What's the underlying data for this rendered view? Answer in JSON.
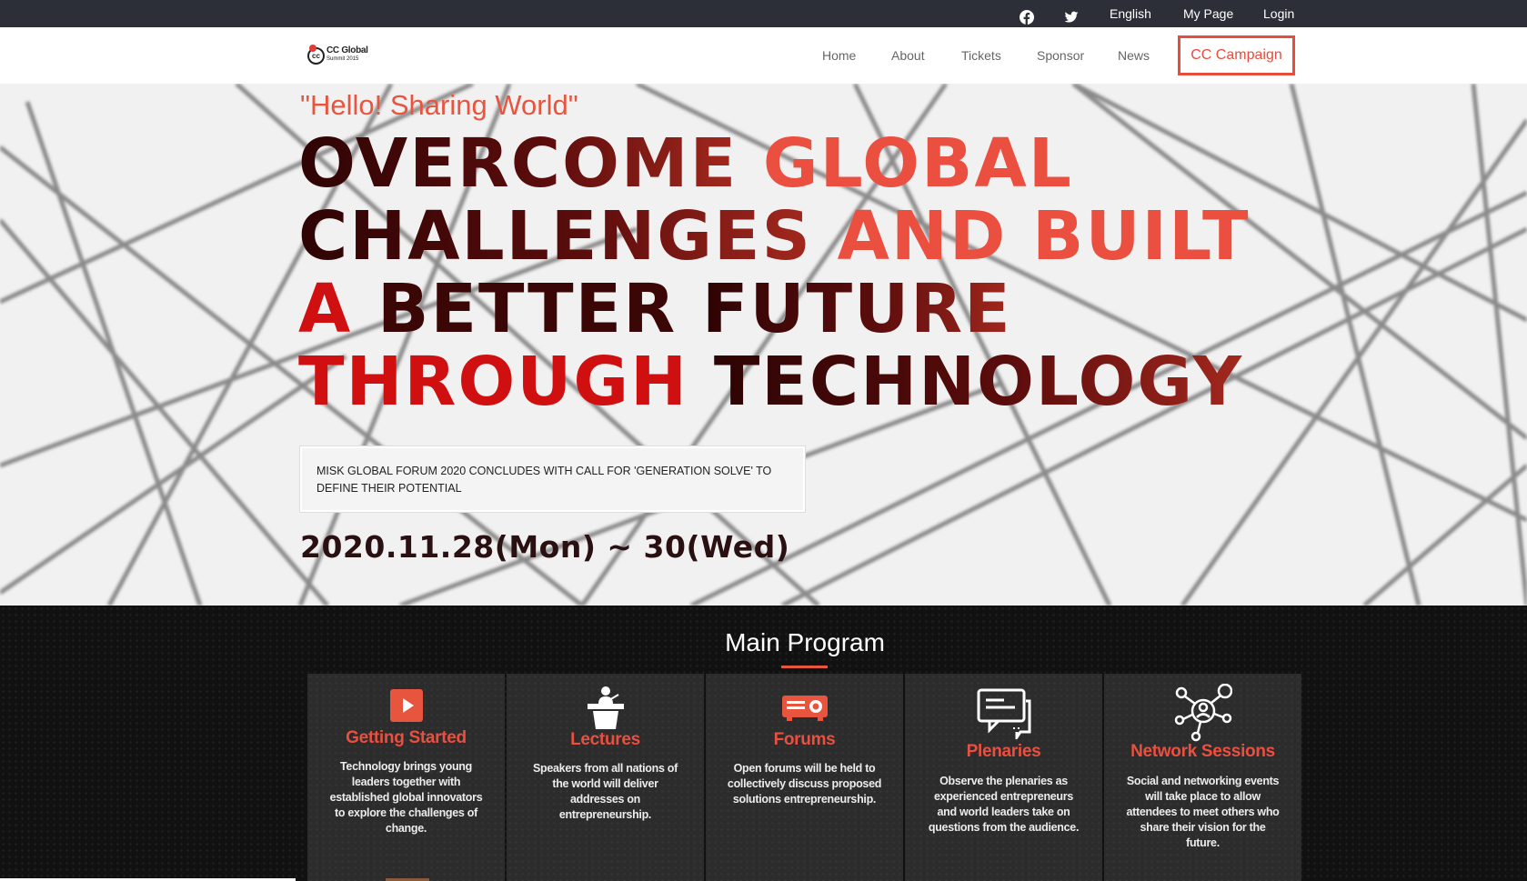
{
  "topbar": {
    "icons": [
      "facebook-icon",
      "twitter-icon"
    ],
    "language": "English",
    "my_page": "My Page",
    "login": "Login"
  },
  "nav": {
    "logo_line1": "CC Global",
    "logo_line2": "Summit 2015",
    "logo_mark": "cc",
    "links": [
      "Home",
      "About",
      "Tickets",
      "Sponsor",
      "News"
    ],
    "cta": "CC Campaign"
  },
  "hero": {
    "tagline": "\"Hello! Sharing World\"",
    "headline": {
      "line1_a": "OVERCOME",
      "line1_b": "GLOBAL",
      "line2_a": "CHALLENGES",
      "line2_b": "AND BUILT",
      "line3_a": "A",
      "line3_b": "BETTER",
      "line3_c": "FUTURE",
      "line4_a": "THROUGH",
      "line4_b": "TECHNOLOGY"
    },
    "news": "MISK GLOBAL FORUM 2020 CONCLUDES WITH CALL FOR 'GENERATION SOLVE' TO DEFINE THEIR POTENTIAL",
    "date": "2020.11.28(Mon) ~ 30(Wed)"
  },
  "program": {
    "title": "Main Program",
    "cards": [
      {
        "icon": "play-icon",
        "title": "Getting Started",
        "desc": "Technology brings young leaders together with established global innovators to explore the challenges of change."
      },
      {
        "icon": "lecturer-podium-icon",
        "title": "Lectures",
        "desc": "Speakers from all nations of the world will deliver addresses on entrepreneurship."
      },
      {
        "icon": "projector-icon",
        "title": "Forums",
        "desc": "Open forums will be held to collectively discuss proposed solutions entrepreneurship."
      },
      {
        "icon": "chat-bubbles-icon",
        "title": "Plenaries",
        "desc": "Observe the plenaries as experienced entrepreneurs and world leaders take on questions from the audience."
      },
      {
        "icon": "network-people-icon",
        "title": "Network Sessions",
        "desc": "Social and networking events will take place to allow attendees to meet others who share their vision for the future."
      }
    ]
  },
  "colors": {
    "accent": "#e8553e",
    "topbar_bg": "#2d2f38",
    "program_bg": "#111111",
    "card_bg": "#2c2c2c"
  }
}
